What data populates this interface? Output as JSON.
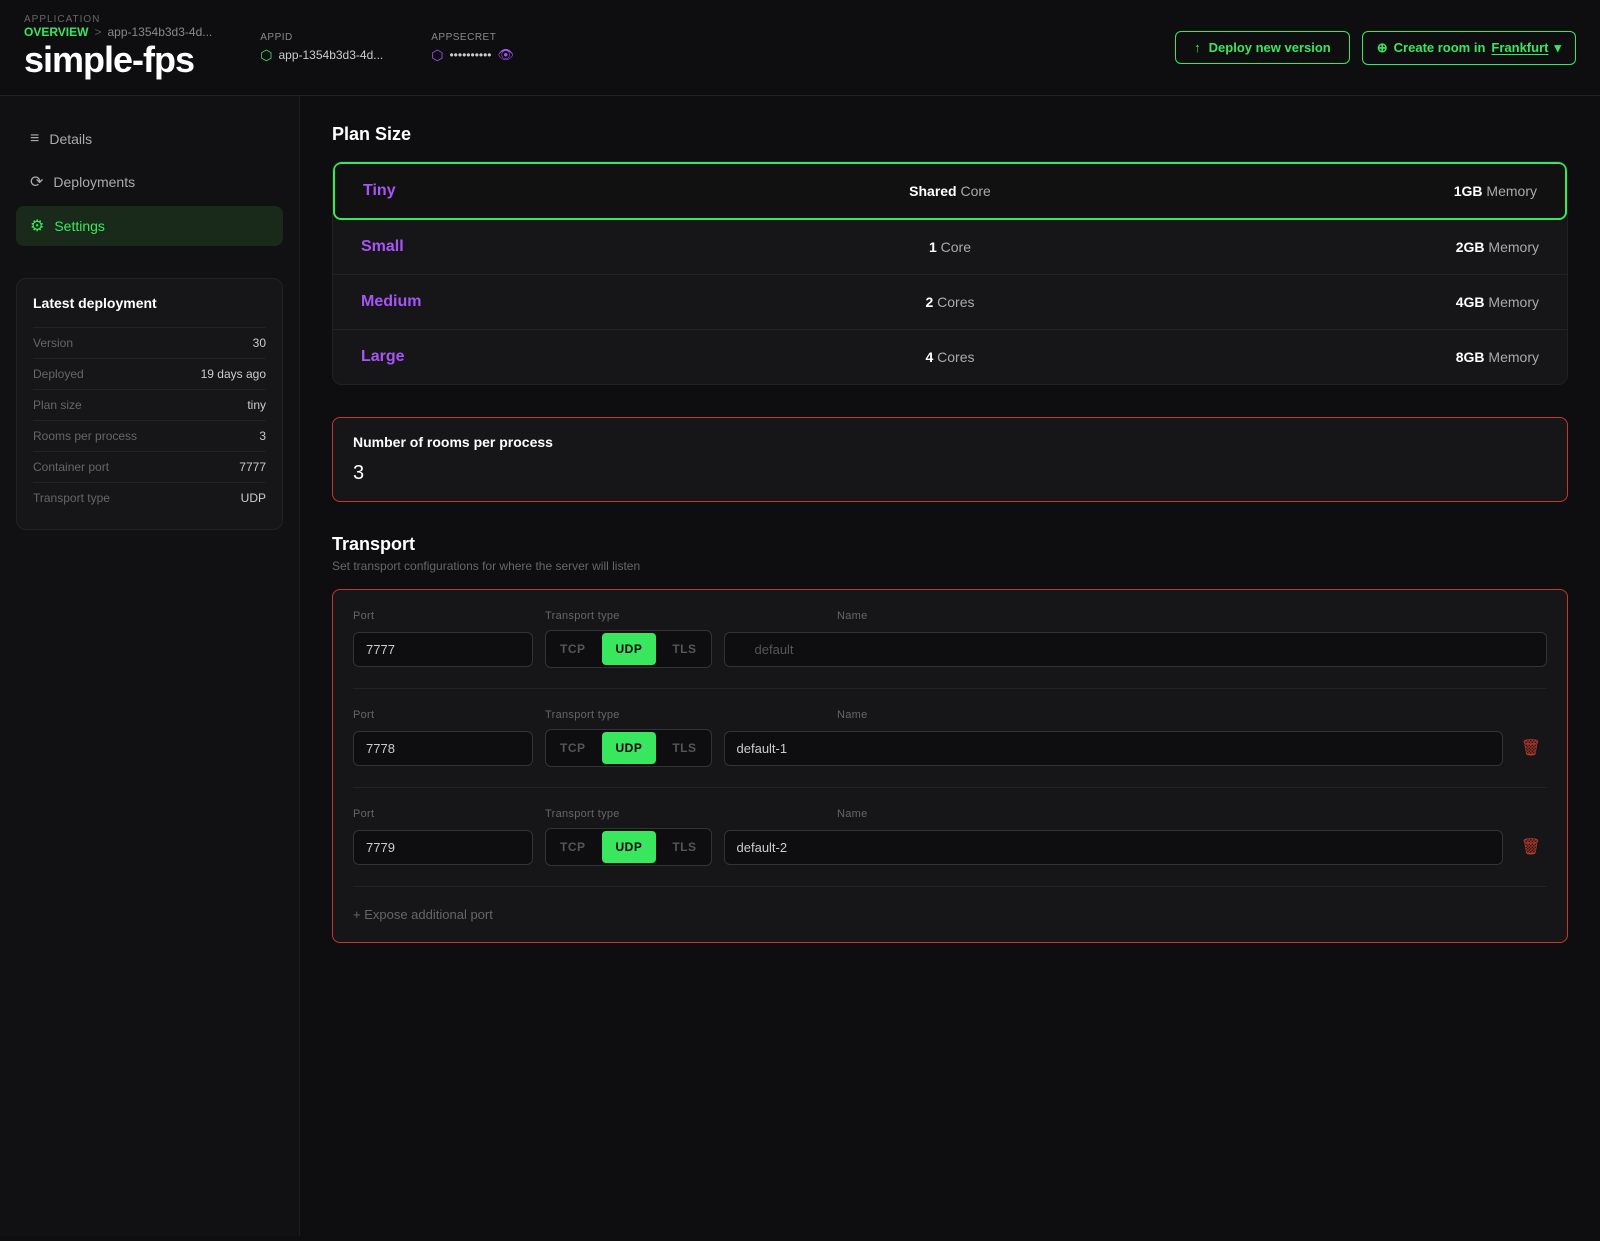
{
  "app": {
    "context_label": "APPLICATION",
    "breadcrumb_overview": "OVERVIEW",
    "breadcrumb_sep": ">",
    "breadcrumb_app": "app-1354b3d3-4d...",
    "title": "simple-fps"
  },
  "header": {
    "appid_label": "AppId",
    "appid_value": "app-1354b3d3-4d...",
    "appsecret_label": "AppSecret",
    "appsecret_value": "••••••••••",
    "deploy_btn": "Deploy new version",
    "create_room_prefix": "Create room in",
    "create_room_location": "Frankfurt"
  },
  "sidebar": {
    "nav_items": [
      {
        "label": "Details",
        "icon": "≡"
      },
      {
        "label": "Deployments",
        "icon": "⟳"
      },
      {
        "label": "Settings",
        "icon": "⚙"
      }
    ],
    "latest_title": "Latest deployment",
    "deploy_rows": [
      {
        "key": "Version",
        "value": "30"
      },
      {
        "key": "Deployed",
        "value": "19 days ago"
      },
      {
        "key": "Plan size",
        "value": "tiny"
      },
      {
        "key": "Rooms per process",
        "value": "3"
      },
      {
        "key": "Container port",
        "value": "7777"
      },
      {
        "key": "Transport type",
        "value": "UDP"
      }
    ]
  },
  "plan_size": {
    "section_title": "Plan Size",
    "plans": [
      {
        "name": "Tiny",
        "core": "Shared Core",
        "memory": "1GB Memory",
        "selected": true
      },
      {
        "name": "Small",
        "core_bold": "1",
        "core_suffix": " Core",
        "memory_bold": "2GB",
        "memory_suffix": " Memory",
        "selected": false
      },
      {
        "name": "Medium",
        "core_bold": "2",
        "core_suffix": " Cores",
        "memory_bold": "4GB",
        "memory_suffix": " Memory",
        "selected": false
      },
      {
        "name": "Large",
        "core_bold": "4",
        "core_suffix": " Cores",
        "memory_bold": "8GB",
        "memory_suffix": " Memory",
        "selected": false
      }
    ]
  },
  "rooms": {
    "label": "Number of rooms per process",
    "value": "3"
  },
  "transport": {
    "title": "Transport",
    "description": "Set transport configurations for where the server will listen",
    "entries": [
      {
        "port": "7777",
        "type": "UDP",
        "name": "default",
        "locked": true
      },
      {
        "port": "7778",
        "type": "UDP",
        "name": "default-1",
        "locked": false
      },
      {
        "port": "7779",
        "type": "UDP",
        "name": "default-2",
        "locked": false
      }
    ],
    "add_port_label": "+ Expose additional port",
    "port_col_label": "Port",
    "type_col_label": "Transport type",
    "name_col_label": "Name",
    "type_options": [
      "TCP",
      "UDP",
      "TLS"
    ]
  }
}
